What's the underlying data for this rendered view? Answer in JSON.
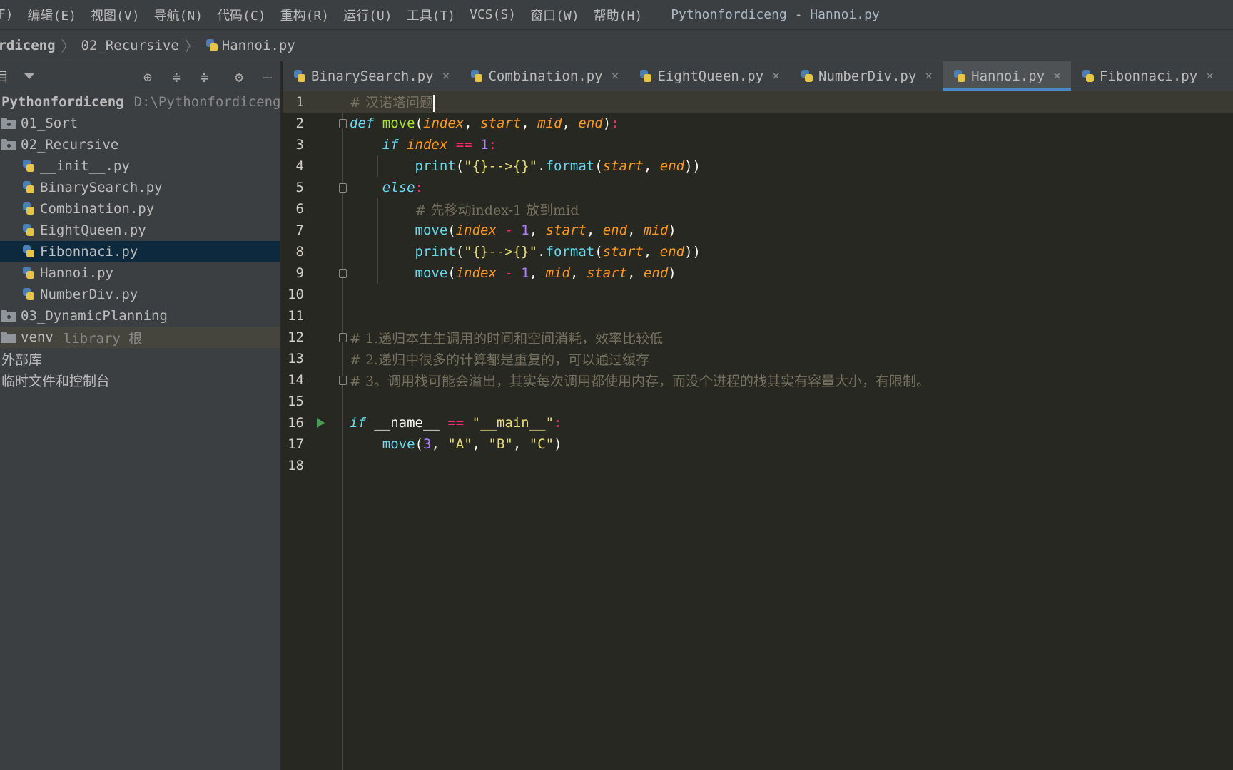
{
  "window_title": "Pythonfordiceng - Hannoi.py",
  "menu": [
    "(F)",
    "编辑(E)",
    "视图(V)",
    "导航(N)",
    "代码(C)",
    "重构(R)",
    "运行(U)",
    "工具(T)",
    "VCS(S)",
    "窗口(W)",
    "帮助(H)"
  ],
  "breadcrumb": {
    "project": "ordiceng",
    "folder": "02_Recursive",
    "file": "Hannoi.py"
  },
  "sidebar": {
    "label": "目",
    "root": {
      "name": "Pythonfordiceng",
      "path": "D:\\Pythonfordiceng"
    },
    "folders": {
      "sort": "01_Sort",
      "recursive": "02_Recursive",
      "dp": "03_DynamicPlanning",
      "venv": "venv",
      "venv_suffix": "library 根"
    },
    "files": [
      "__init__.py",
      "BinarySearch.py",
      "Combination.py",
      "EightQueen.py",
      "Fibonnaci.py",
      "Hannoi.py",
      "NumberDiv.py"
    ],
    "external_libs": "外部库",
    "scratches": "临时文件和控制台"
  },
  "tabs": [
    "BinarySearch.py",
    "Combination.py",
    "EightQueen.py",
    "NumberDiv.py",
    "Hannoi.py",
    "Fibonnaci.py"
  ],
  "active_tab": "Hannoi.py",
  "code": {
    "l1": "# 汉诺塔问题",
    "l2": {
      "kw": "def",
      "fn": "move",
      "p1": "index",
      "p2": "start",
      "p3": "mid",
      "p4": "end"
    },
    "l3": {
      "kw": "if",
      "p": "index",
      "op": "==",
      "num": "1"
    },
    "l4": {
      "fn": "print",
      "str": "\"{}-->{}\"",
      "meth": "format",
      "p1": "start",
      "p2": "end"
    },
    "l5": {
      "kw": "else"
    },
    "l6": "# 先移动index-1 放到mid",
    "l7": {
      "fn": "move",
      "p1": "index",
      "op": "-",
      "num": "1",
      "p2": "start",
      "p3": "end",
      "p4": "mid"
    },
    "l8": {
      "fn": "print",
      "str": "\"{}-->{}\"",
      "meth": "format",
      "p1": "start",
      "p2": "end"
    },
    "l9": {
      "fn": "move",
      "p1": "index",
      "op": "-",
      "num": "1",
      "p2": "mid",
      "p3": "start",
      "p4": "end"
    },
    "l12": "# 1.递归本生生调用的时间和空间消耗，效率比较低",
    "l13": "# 2.递归中很多的计算都是重复的，可以通过缓存",
    "l14": "# 3。调用栈可能会溢出，其实每次调用都使用内存，而没个进程的栈其实有容量大小，有限制。",
    "l16": {
      "kw": "if",
      "name": "__name__",
      "op": "==",
      "str": "\"__main__\""
    },
    "l17": {
      "fn": "move",
      "num": "3",
      "s1": "\"A\"",
      "s2": "\"B\"",
      "s3": "\"C\""
    }
  },
  "line_numbers": [
    "1",
    "2",
    "3",
    "4",
    "5",
    "6",
    "7",
    "8",
    "9",
    "10",
    "11",
    "12",
    "13",
    "14",
    "15",
    "16",
    "17",
    "18"
  ]
}
